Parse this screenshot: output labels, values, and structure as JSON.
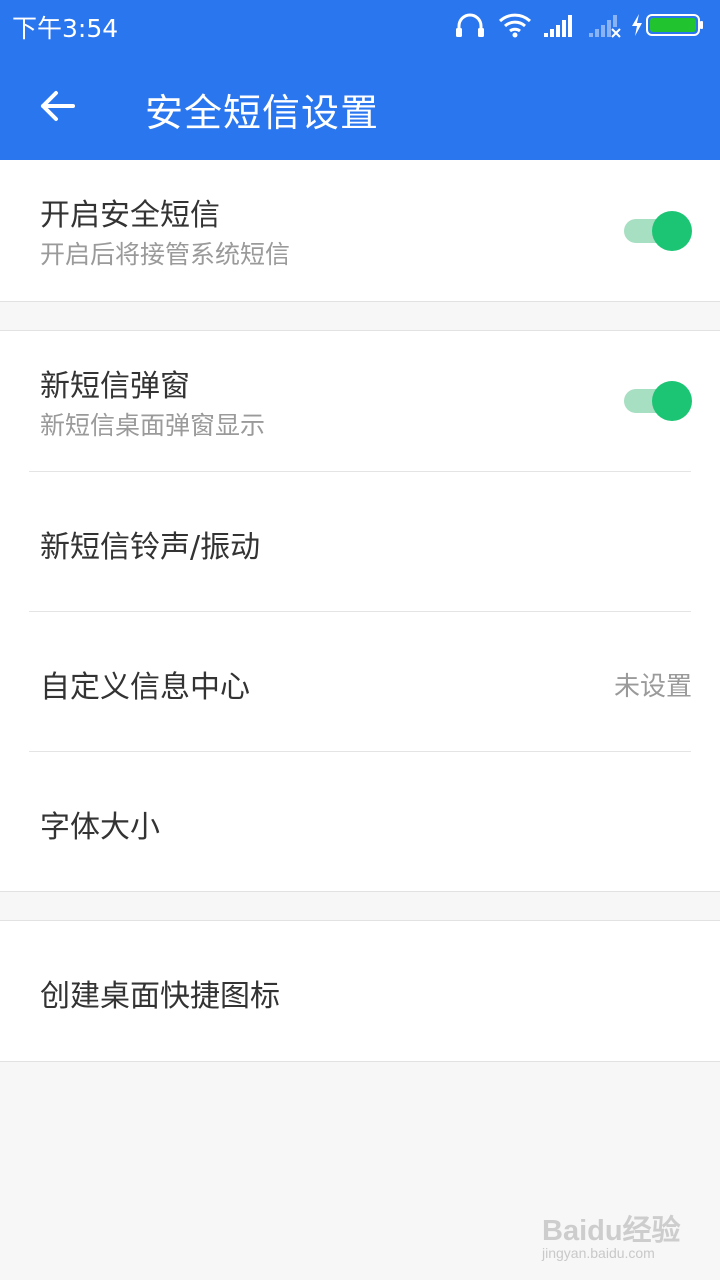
{
  "status_bar": {
    "time": "下午3:54",
    "icons": [
      "headphones-icon",
      "wifi-icon",
      "signal-icon",
      "signal-no-sim-icon",
      "charging-icon",
      "battery-icon"
    ],
    "battery_color": "#21c42e"
  },
  "header": {
    "title": "安全短信设置",
    "background": "#2a76ef"
  },
  "settings": {
    "enable_secure_sms": {
      "title": "开启安全短信",
      "subtitle": "开启后将接管系统短信",
      "enabled": true
    },
    "new_sms_popup": {
      "title": "新短信弹窗",
      "subtitle": "新短信桌面弹窗显示",
      "enabled": true
    },
    "ringtone_vibration": {
      "title": "新短信铃声/振动"
    },
    "custom_message_center": {
      "title": "自定义信息中心",
      "value": "未设置"
    },
    "font_size": {
      "title": "字体大小"
    },
    "create_shortcut": {
      "title": "创建桌面快捷图标"
    },
    "toggle_color": "#1bc574"
  },
  "watermark": {
    "text": "Baidu经验",
    "sub": "jingyan.baidu.com"
  }
}
